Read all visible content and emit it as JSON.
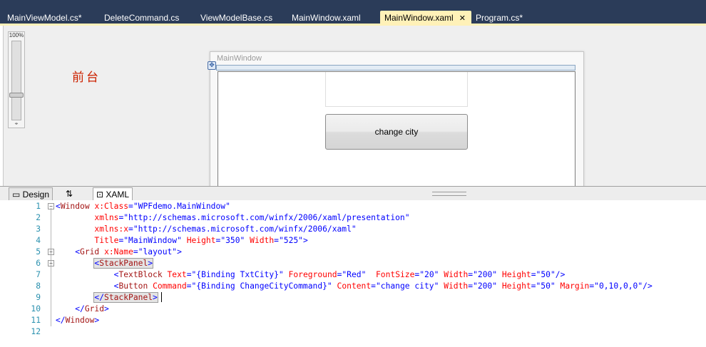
{
  "doc_tabs": [
    {
      "label": "MainViewModel.cs*",
      "active": false
    },
    {
      "label": "DeleteCommand.cs",
      "active": false
    },
    {
      "label": "ViewModelBase.cs",
      "active": false
    },
    {
      "label": "MainWindow.xaml",
      "active": false
    },
    {
      "label": "MainWindow.xaml",
      "active": true
    },
    {
      "label": "Program.cs*",
      "active": false
    }
  ],
  "designer": {
    "zoom_label": "100%",
    "annotation": "前台",
    "window_title": "MainWindow",
    "button_label": "change city",
    "zoom_level": 0.35
  },
  "view_tabs": {
    "design": "Design",
    "swap": "⇅",
    "xaml": "XAML"
  },
  "code_lines": [
    {
      "n": "1",
      "text": "<Window x:Class=\"WPFdemo.MainWindow\""
    },
    {
      "n": "2",
      "text": "        xmlns=\"http://schemas.microsoft.com/winfx/2006/xaml/presentation\""
    },
    {
      "n": "3",
      "text": "        xmlns:x=\"http://schemas.microsoft.com/winfx/2006/xaml\""
    },
    {
      "n": "4",
      "text": "        Title=\"MainWindow\" Height=\"350\" Width=\"525\">"
    },
    {
      "n": "5",
      "text": "    <Grid x:Name=\"layout\">"
    },
    {
      "n": "6",
      "text": "        <StackPanel>"
    },
    {
      "n": "7",
      "text": "            <TextBlock Text=\"{Binding TxtCity}\" Foreground=\"Red\"  FontSize=\"20\" Width=\"200\" Height=\"50\"/>"
    },
    {
      "n": "8",
      "text": "            <Button Command=\"{Binding ChangeCityCommand}\" Content=\"change city\" Width=\"200\" Height=\"50\" Margin=\"0,10,0,0\"/>"
    },
    {
      "n": "9",
      "text": "        </StackPanel>"
    },
    {
      "n": "10",
      "text": "    </Grid>"
    },
    {
      "n": "11",
      "text": "</Window>"
    },
    {
      "n": "12",
      "text": ""
    }
  ],
  "colors": {
    "tab_bar": "#2b3c59",
    "active_tab": "#fff1b8",
    "annotation": "#cc2200",
    "xml_tag": "#a31515",
    "xml_attr": "#ff0000",
    "xml_value": "#0000ff",
    "line_number": "#2b91af"
  }
}
